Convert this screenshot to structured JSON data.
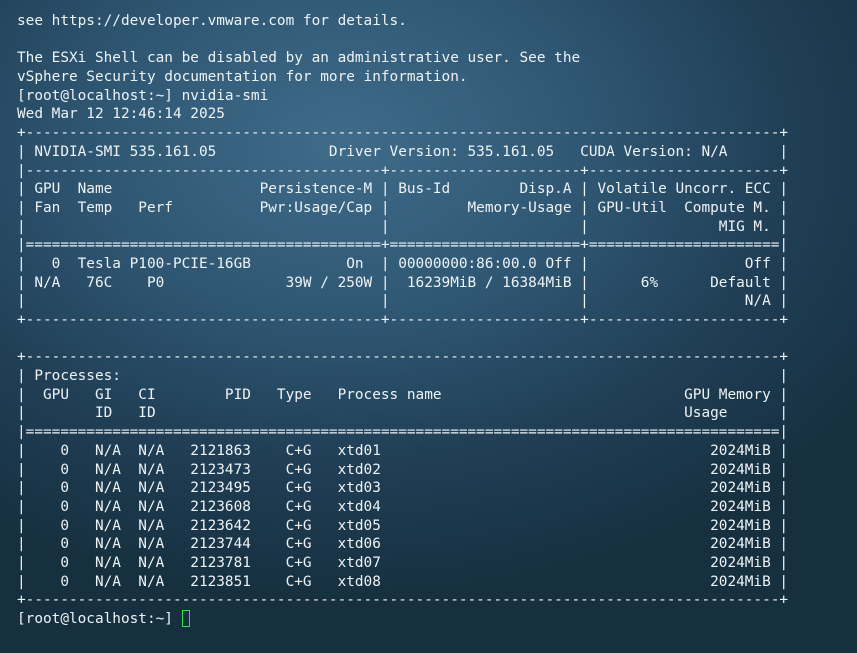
{
  "terminal": {
    "lines": [
      "see https://developer.vmware.com for details.",
      "",
      "The ESXi Shell can be disabled by an administrative user. See the",
      "vSphere Security documentation for more information.",
      "[root@localhost:~] nvidia-smi",
      "Wed Mar 12 12:46:14 2025",
      "+---------------------------------------------------------------------------------------+",
      "| NVIDIA-SMI 535.161.05             Driver Version: 535.161.05   CUDA Version: N/A      |",
      "|-----------------------------------------+----------------------+----------------------+",
      "| GPU  Name                 Persistence-M | Bus-Id        Disp.A | Volatile Uncorr. ECC |",
      "| Fan  Temp   Perf          Pwr:Usage/Cap |         Memory-Usage | GPU-Util  Compute M. |",
      "|                                         |                      |               MIG M. |",
      "|=========================================+======================+======================|",
      "|   0  Tesla P100-PCIE-16GB           On  | 00000000:86:00.0 Off |                  Off |",
      "| N/A   76C    P0              39W / 250W |  16239MiB / 16384MiB |      6%      Default |",
      "|                                         |                      |                  N/A |",
      "+-----------------------------------------+----------------------+----------------------+",
      "",
      "+---------------------------------------------------------------------------------------+",
      "| Processes:                                                                            |",
      "|  GPU   GI   CI        PID   Type   Process name                            GPU Memory |",
      "|        ID   ID                                                             Usage      |",
      "|=======================================================================================|",
      "|    0   N/A  N/A   2121863    C+G   xtd01                                      2024MiB |",
      "|    0   N/A  N/A   2123473    C+G   xtd02                                      2024MiB |",
      "|    0   N/A  N/A   2123495    C+G   xtd03                                      2024MiB |",
      "|    0   N/A  N/A   2123608    C+G   xtd04                                      2024MiB |",
      "|    0   N/A  N/A   2123642    C+G   xtd05                                      2024MiB |",
      "|    0   N/A  N/A   2123744    C+G   xtd06                                      2024MiB |",
      "|    0   N/A  N/A   2123781    C+G   xtd07                                      2024MiB |",
      "|    0   N/A  N/A   2123851    C+G   xtd08                                      2024MiB |",
      "+---------------------------------------------------------------------------------------+"
    ],
    "prompt": "[root@localhost:~] ",
    "cursor_color": "#2de83d"
  }
}
